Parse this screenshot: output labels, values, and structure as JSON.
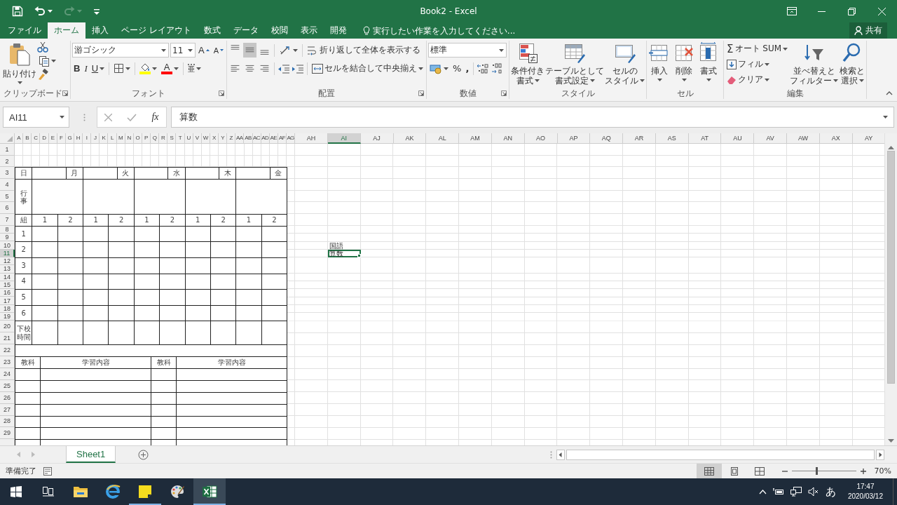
{
  "window": {
    "title": "Book2 - Excel"
  },
  "quick_access": [
    {
      "kind": "save",
      "disabled": false
    },
    {
      "kind": "undo",
      "disabled": false
    },
    {
      "kind": "redo",
      "disabled": true
    },
    {
      "kind": "customize",
      "disabled": false
    }
  ],
  "ribbon_tabs": [
    {
      "label": "ファイル",
      "selected": false
    },
    {
      "label": "ホーム",
      "selected": true
    },
    {
      "label": "挿入",
      "selected": false
    },
    {
      "label": "ページ レイアウト",
      "selected": false
    },
    {
      "label": "数式",
      "selected": false
    },
    {
      "label": "データ",
      "selected": false
    },
    {
      "label": "校閲",
      "selected": false
    },
    {
      "label": "表示",
      "selected": false
    },
    {
      "label": "開発",
      "selected": false
    }
  ],
  "tell_me": {
    "placeholder": "実行したい作業を入力してください..."
  },
  "share": {
    "label": "共有"
  },
  "clipboard": {
    "title": "クリップボード",
    "paste": "貼り付け"
  },
  "font": {
    "title": "フォント",
    "name": "游ゴシック",
    "size": "11",
    "grow": "A",
    "shrink": "A",
    "bold": "B",
    "italic": "I",
    "underline": "U",
    "font_color_label": "A",
    "phonetic": "亜"
  },
  "alignment": {
    "title": "配置",
    "vertical": [
      {
        "kind": "top",
        "selected": false
      },
      {
        "kind": "middle",
        "selected": true
      },
      {
        "kind": "bottom",
        "selected": false
      }
    ],
    "horizontal": [
      {
        "kind": "left",
        "selected": false
      },
      {
        "kind": "center",
        "selected": false
      },
      {
        "kind": "right",
        "selected": false
      }
    ],
    "wrap_text": "折り返して全体を表示する",
    "merge_center": "セルを結合して中央揃え"
  },
  "number": {
    "title": "数値",
    "format": "標準",
    "percent": "%",
    "comma": ","
  },
  "styles": {
    "title": "スタイル",
    "buttons": [
      {
        "kind": "conditional",
        "label_lines": [
          "条件付き",
          "書式"
        ]
      },
      {
        "kind": "table",
        "label_lines": [
          "テーブルとして",
          "書式設定"
        ]
      },
      {
        "kind": "cell",
        "label_lines": [
          "セルの",
          "スタイル"
        ]
      }
    ]
  },
  "cells": {
    "title": "セル",
    "buttons": [
      {
        "kind": "insert",
        "label": "挿入"
      },
      {
        "kind": "delete",
        "label": "削除"
      },
      {
        "kind": "format",
        "label": "書式"
      }
    ]
  },
  "editing": {
    "title": "編集",
    "autosum_icon": "Σ",
    "autosum": "オート SUM",
    "fill": "フィル",
    "clear": "クリア",
    "sort_lines": [
      "並べ替えと",
      "フィルター"
    ],
    "find_lines": [
      "検索と",
      "選択"
    ]
  },
  "formula_bar": {
    "name_box": "AI11",
    "fx": "fx",
    "value": "算数"
  },
  "sheet": {
    "column_headers": [
      {
        "label": "A",
        "selected": false
      },
      {
        "label": "B",
        "selected": false
      },
      {
        "label": "C",
        "selected": false
      },
      {
        "label": "D",
        "selected": false
      },
      {
        "label": "E",
        "selected": false
      },
      {
        "label": "F",
        "selected": false
      },
      {
        "label": "G",
        "selected": false
      },
      {
        "label": "H",
        "selected": false
      },
      {
        "label": "I",
        "selected": false
      },
      {
        "label": "J",
        "selected": false
      },
      {
        "label": "K",
        "selected": false
      },
      {
        "label": "L",
        "selected": false
      },
      {
        "label": "M",
        "selected": false
      },
      {
        "label": "N",
        "selected": false
      },
      {
        "label": "O",
        "selected": false
      },
      {
        "label": "P",
        "selected": false
      },
      {
        "label": "Q",
        "selected": false
      },
      {
        "label": "R",
        "selected": false
      },
      {
        "label": "S",
        "selected": false
      },
      {
        "label": "T",
        "selected": false
      },
      {
        "label": "U",
        "selected": false
      },
      {
        "label": "V",
        "selected": false
      },
      {
        "label": "W",
        "selected": false
      },
      {
        "label": "X",
        "selected": false
      },
      {
        "label": "Y",
        "selected": false
      },
      {
        "label": "Z",
        "selected": false
      },
      {
        "label": "AA",
        "selected": false
      },
      {
        "label": "AB",
        "selected": false
      },
      {
        "label": "AC",
        "selected": false
      },
      {
        "label": "AD",
        "selected": false
      },
      {
        "label": "AE",
        "selected": false
      },
      {
        "label": "AF",
        "selected": false
      },
      {
        "label": "AG",
        "selected": false
      },
      {
        "label": "AH",
        "selected": false
      },
      {
        "label": "AI",
        "selected": true
      },
      {
        "label": "AJ",
        "selected": false
      },
      {
        "label": "AK",
        "selected": false
      },
      {
        "label": "AL",
        "selected": false
      },
      {
        "label": "AM",
        "selected": false
      },
      {
        "label": "AN",
        "selected": false
      },
      {
        "label": "AO",
        "selected": false
      },
      {
        "label": "AP",
        "selected": false
      },
      {
        "label": "AQ",
        "selected": false
      },
      {
        "label": "AR",
        "selected": false
      },
      {
        "label": "AS",
        "selected": false
      },
      {
        "label": "AT",
        "selected": false
      },
      {
        "label": "AU",
        "selected": false
      },
      {
        "label": "AV",
        "selected": false
      },
      {
        "label": "AW",
        "selected": false
      },
      {
        "label": "AX",
        "selected": false
      },
      {
        "label": "AY",
        "selected": false
      }
    ],
    "row_headers": [
      {
        "label": "1",
        "selected": false
      },
      {
        "label": "2",
        "selected": false
      },
      {
        "label": "3",
        "selected": false
      },
      {
        "label": "4",
        "selected": false
      },
      {
        "label": "5",
        "selected": false
      },
      {
        "label": "6",
        "selected": false
      },
      {
        "label": "7",
        "selected": false
      },
      {
        "label": "8",
        "selected": false
      },
      {
        "label": "9",
        "selected": false
      },
      {
        "label": "10",
        "selected": false
      },
      {
        "label": "11",
        "selected": true
      },
      {
        "label": "12",
        "selected": false
      },
      {
        "label": "13",
        "selected": false
      },
      {
        "label": "14",
        "selected": false
      },
      {
        "label": "15",
        "selected": false
      },
      {
        "label": "16",
        "selected": false
      },
      {
        "label": "17",
        "selected": false
      },
      {
        "label": "18",
        "selected": false
      },
      {
        "label": "19",
        "selected": false
      },
      {
        "label": "20",
        "selected": false
      },
      {
        "label": "21",
        "selected": false
      },
      {
        "label": "22",
        "selected": false
      },
      {
        "label": "23",
        "selected": false
      },
      {
        "label": "24",
        "selected": false
      },
      {
        "label": "25",
        "selected": false
      },
      {
        "label": "26",
        "selected": false
      },
      {
        "label": "27",
        "selected": false
      },
      {
        "label": "28",
        "selected": false
      },
      {
        "label": "29",
        "selected": false
      }
    ],
    "form": {
      "days": [
        "日",
        "月",
        "火",
        "水",
        "木",
        "金"
      ],
      "events_label": "行事",
      "group_label": "組",
      "groups": [
        "1",
        "2",
        "1",
        "2",
        "1",
        "2",
        "1",
        "2",
        "1",
        "2"
      ],
      "periods": [
        "1",
        "2",
        "3",
        "4",
        "5",
        "6"
      ],
      "dismissal_label": "下校時間",
      "notes_headers": [
        {
          "subject": "教科",
          "content": "学習内容"
        },
        {
          "subject": "教科",
          "content": "学習内容"
        }
      ]
    },
    "cells": [
      {
        "text": "国語",
        "selected": false
      },
      {
        "text": "算数",
        "selected": true
      }
    ]
  },
  "sheet_tabs": [
    {
      "label": "Sheet1",
      "selected": true
    }
  ],
  "status_bar": {
    "status": "準備完了",
    "views": [
      {
        "kind": "normal",
        "selected": true
      },
      {
        "kind": "page_layout",
        "selected": false
      },
      {
        "kind": "page_break",
        "selected": false
      }
    ],
    "zoom": {
      "level": 0.38,
      "reading": "70%"
    }
  },
  "taskbar": {
    "apps": [
      {
        "kind": "explorer",
        "running": false,
        "active": false
      },
      {
        "kind": "browser",
        "running": false,
        "active": false
      },
      {
        "kind": "notes",
        "running": true,
        "active": false
      },
      {
        "kind": "paint",
        "running": false,
        "active": false
      },
      {
        "kind": "excel",
        "running": true,
        "active": true
      }
    ],
    "ime": "あ",
    "time": "17:47",
    "date": "2020/03/12"
  }
}
